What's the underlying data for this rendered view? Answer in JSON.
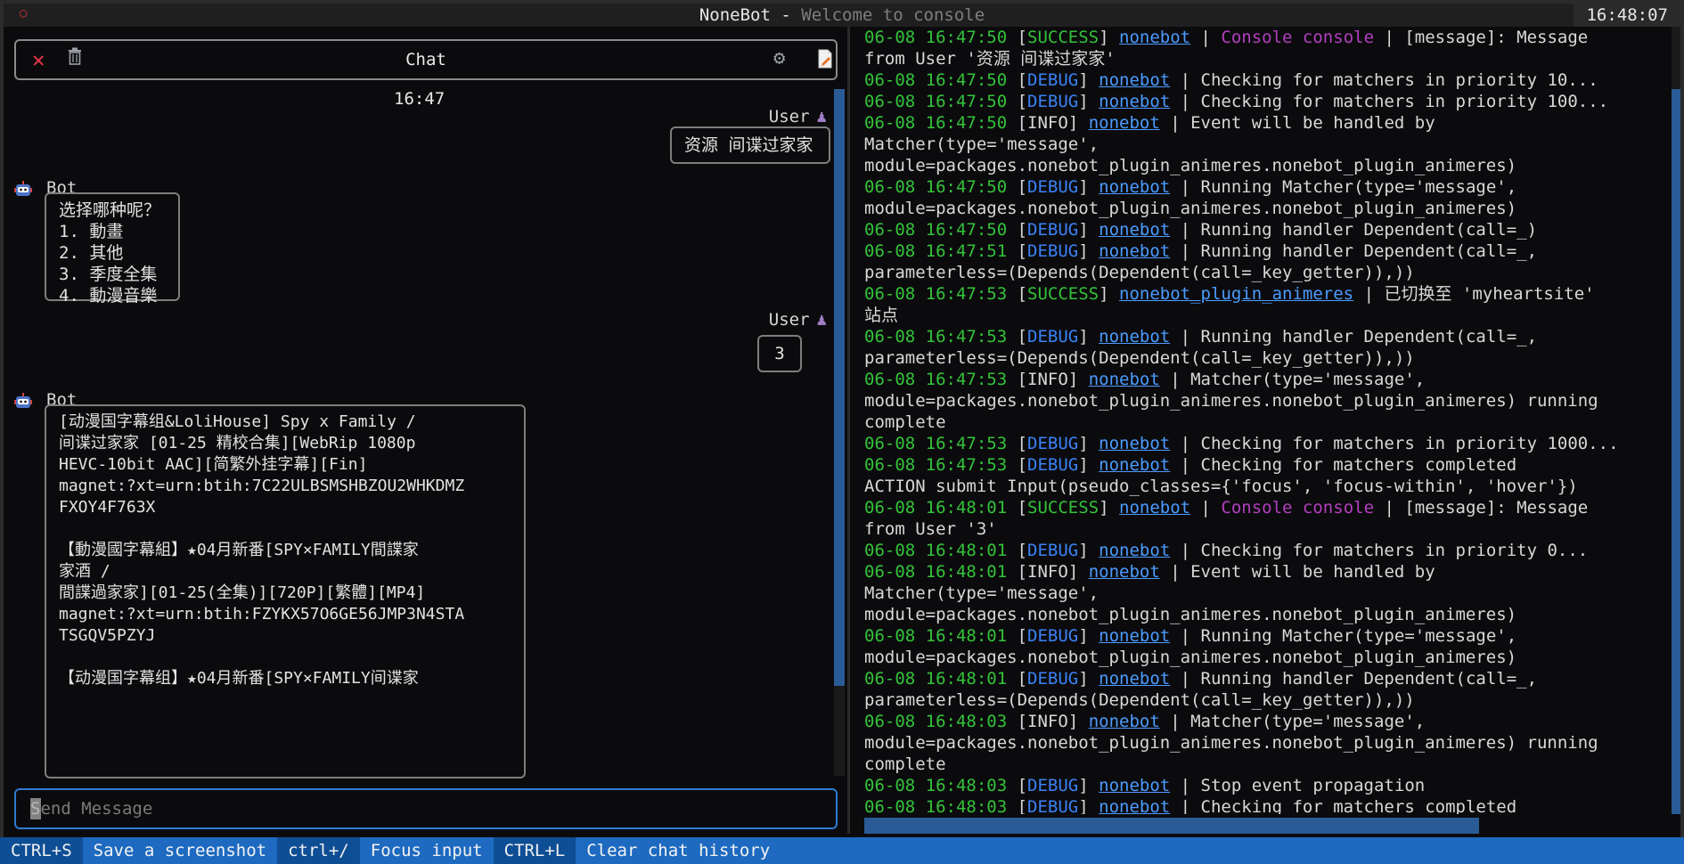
{
  "window": {
    "title": "NoneBot",
    "separator": " - ",
    "subtitle": "Welcome to console",
    "clock": "16:48:07"
  },
  "chat": {
    "title": "Chat",
    "time": "16:47",
    "input_placeholder": "Send Message",
    "messages": [
      {
        "sender": "User",
        "text": "资源 间谍过家家"
      },
      {
        "sender": "Bot",
        "text": "选择哪种呢？\n1. 動畫\n2. 其他\n3. 季度全集\n4. 動漫音樂"
      },
      {
        "sender": "User",
        "text": "3"
      },
      {
        "sender": "Bot",
        "text": "[动漫国字幕组&LoliHouse] Spy x Family /\n间谍过家家 [01-25 精校合集][WebRip 1080p\nHEVC-10bit AAC][简繁外挂字幕][Fin]\nmagnet:?xt=urn:btih:7C22ULBSMSHBZOU2WHKDMZ\nFXOY4F763X\n\n【動漫國字幕組】★04月新番[SPY×FAMILY間諜家\n家酒 /\n間諜過家家][01-25(全集)][720P][繁體][MP4]\nmagnet:?xt=urn:btih:FZYKX57O6GE56JMP3N4STA\nTSGQV5PZYJ\n\n【动漫国字幕组】★04月新番[SPY×FAMILY间谍家"
      }
    ]
  },
  "log": {
    "lines": [
      {
        "ts": "06-08 16:47:50",
        "level": "SUCCESS",
        "src": "nonebot",
        "console": "Console console",
        "text": " | [message]: Message\nfrom User '资源 间谍过家家'"
      },
      {
        "ts": "06-08 16:47:50",
        "level": "DEBUG",
        "src": "nonebot",
        "text": " | Checking for matchers in priority 10..."
      },
      {
        "ts": "06-08 16:47:50",
        "level": "DEBUG",
        "src": "nonebot",
        "text": " | Checking for matchers in priority 100..."
      },
      {
        "ts": "06-08 16:47:50",
        "level": "INFO",
        "src": "nonebot",
        "text": " | Event will be handled by\nMatcher(type='message',\nmodule=packages.nonebot_plugin_animeres.nonebot_plugin_animeres)"
      },
      {
        "ts": "06-08 16:47:50",
        "level": "DEBUG",
        "src": "nonebot",
        "text": " | Running Matcher(type='message',\nmodule=packages.nonebot_plugin_animeres.nonebot_plugin_animeres)"
      },
      {
        "ts": "06-08 16:47:50",
        "level": "DEBUG",
        "src": "nonebot",
        "text": " | Running handler Dependent(call=_)"
      },
      {
        "ts": "06-08 16:47:51",
        "level": "DEBUG",
        "src": "nonebot",
        "text": " | Running handler Dependent(call=_,\nparameterless=(Depends(Dependent(call=_key_getter)),))"
      },
      {
        "ts": "06-08 16:47:53",
        "level": "SUCCESS",
        "src": "nonebot_plugin_animeres",
        "text": " | 已切换至 'myheartsite'\n站点"
      },
      {
        "ts": "06-08 16:47:53",
        "level": "DEBUG",
        "src": "nonebot",
        "text": " | Running handler Dependent(call=_,\nparameterless=(Depends(Dependent(call=_key_getter)),))"
      },
      {
        "ts": "06-08 16:47:53",
        "level": "INFO",
        "src": "nonebot",
        "text": " | Matcher(type='message',\nmodule=packages.nonebot_plugin_animeres.nonebot_plugin_animeres) running\ncomplete"
      },
      {
        "ts": "06-08 16:47:53",
        "level": "DEBUG",
        "src": "nonebot",
        "text": " | Checking for matchers in priority 1000..."
      },
      {
        "ts": "06-08 16:47:53",
        "level": "DEBUG",
        "src": "nonebot",
        "text": " | Checking for matchers completed"
      },
      {
        "raw": "ACTION submit Input(pseudo_classes={'focus', 'focus-within', 'hover'})"
      },
      {
        "ts": "06-08 16:48:01",
        "level": "SUCCESS",
        "src": "nonebot",
        "console": "Console console",
        "text": " | [message]: Message\nfrom User '3'"
      },
      {
        "ts": "06-08 16:48:01",
        "level": "DEBUG",
        "src": "nonebot",
        "text": " | Checking for matchers in priority 0..."
      },
      {
        "ts": "06-08 16:48:01",
        "level": "INFO",
        "src": "nonebot",
        "text": " | Event will be handled by\nMatcher(type='message',\nmodule=packages.nonebot_plugin_animeres.nonebot_plugin_animeres)"
      },
      {
        "ts": "06-08 16:48:01",
        "level": "DEBUG",
        "src": "nonebot",
        "text": " | Running Matcher(type='message',\nmodule=packages.nonebot_plugin_animeres.nonebot_plugin_animeres)"
      },
      {
        "ts": "06-08 16:48:01",
        "level": "DEBUG",
        "src": "nonebot",
        "text": " | Running handler Dependent(call=_,\nparameterless=(Depends(Dependent(call=_key_getter)),))"
      },
      {
        "ts": "06-08 16:48:03",
        "level": "INFO",
        "src": "nonebot",
        "text": " | Matcher(type='message',\nmodule=packages.nonebot_plugin_animeres.nonebot_plugin_animeres) running\ncomplete"
      },
      {
        "ts": "06-08 16:48:03",
        "level": "DEBUG",
        "src": "nonebot",
        "text": " | Stop event propagation"
      },
      {
        "ts": "06-08 16:48:03",
        "level": "DEBUG",
        "src": "nonebot",
        "text": " | Checking for matchers completed"
      }
    ]
  },
  "footer": {
    "items": [
      {
        "key": "CTRL+S",
        "desc": "Save a screenshot"
      },
      {
        "key": "ctrl+/",
        "desc": "Focus input"
      },
      {
        "key": "CTRL+L",
        "desc": "Clear chat history"
      }
    ]
  },
  "colors": {
    "accent": "#1d6ac0",
    "success": "#34c23a",
    "debug": "#3b82f6",
    "link": "#4c9bff",
    "console": "#b33fbf",
    "close": "#e8344a"
  },
  "icons": {
    "close": "close-icon",
    "trash": "trash-icon",
    "settings": "gear-icon",
    "export": "note-icon",
    "user_avatar": "person-icon",
    "bot_avatar": "robot-icon"
  }
}
